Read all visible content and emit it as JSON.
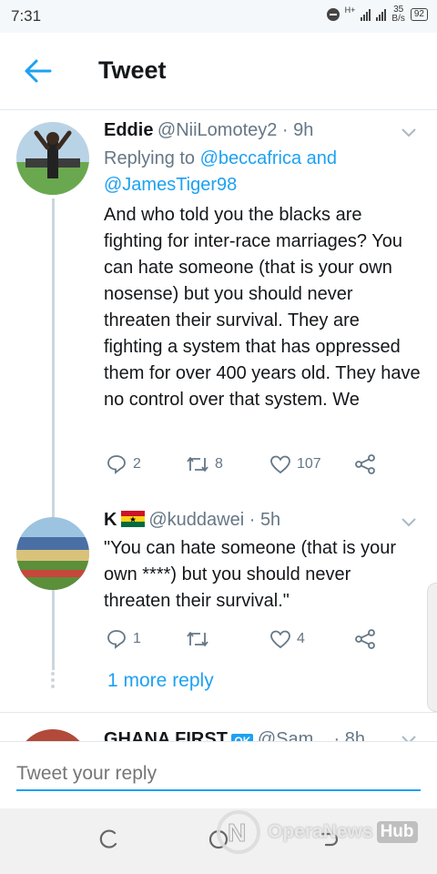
{
  "status": {
    "time": "7:31",
    "net": "H+",
    "speed_value": "35",
    "speed_unit": "B/s",
    "battery": "92"
  },
  "header": {
    "title": "Tweet"
  },
  "tweets": [
    {
      "name": "Eddie",
      "handle": "@NiiLomotey2 · 9h",
      "replying_prefix": "Replying to ",
      "replying_a": "@beccafrica",
      "replying_and": " and",
      "replying_b": "@JamesTiger98",
      "text": "And who told you the blacks are fighting for inter-race marriages? You can hate someone (that is your own nosense) but you should never threaten their survival. They are fighting a system that has oppressed them for over 400 years old. They have no control over that system. We",
      "replies": "2",
      "retweets": "8",
      "likes": "107"
    },
    {
      "name": "K",
      "handle": "@kuddawei · 5h",
      "text": "\"You can hate someone (that is your own ****) but you should never threaten their survival.\"",
      "replies": "1",
      "retweets": "",
      "likes": "4"
    },
    {
      "name": "GHANA FIRST",
      "badge": "OK",
      "handle": "@Sam... · 8h"
    }
  ],
  "more_reply": "1 more reply",
  "reply_placeholder": "Tweet your reply",
  "watermark": {
    "brand": "OperaNews",
    "hub": "Hub"
  },
  "colors": {
    "accent": "#1da1f2",
    "muted": "#657786",
    "line": "#ccd6dd"
  },
  "icons": [
    "back-arrow-icon",
    "caret-down-icon",
    "reply-icon",
    "retweet-icon",
    "like-icon",
    "share-icon",
    "ghana-flag-icon",
    "recents-icon",
    "home-icon"
  ]
}
